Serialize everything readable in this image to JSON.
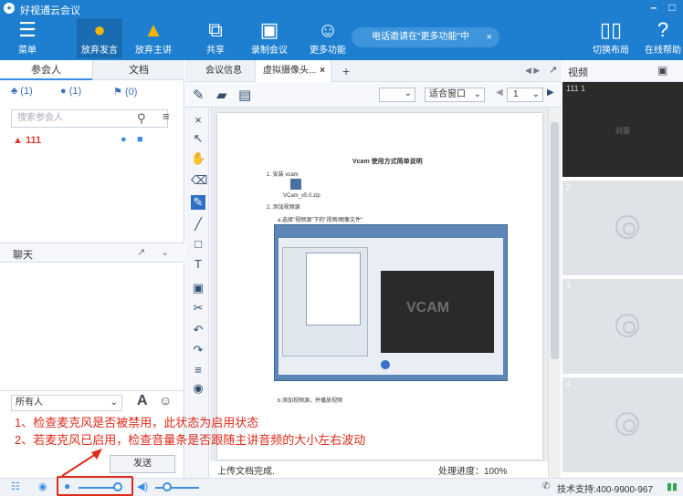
{
  "app": {
    "title": "好视通云会议"
  },
  "toolbar": {
    "menu": "菜单",
    "give_up_speaking": "放弃发言",
    "give_up_presenter": "放弃主讲",
    "share": "共享",
    "record": "录制会议",
    "more": "更多功能",
    "notice": "电话邀请在\"更多功能\"中",
    "switch_layout": "切换布局",
    "online_help": "在线帮助"
  },
  "left": {
    "tab_participants": "参会人",
    "tab_docs": "文档",
    "stats": [
      "(1)",
      "(1)",
      "(0)"
    ],
    "search_placeholder": "搜索参会人",
    "member_name": "111",
    "chat_label": "聊天",
    "recipient": "所有人",
    "send": "发送"
  },
  "center": {
    "tab_info": "会议信息",
    "tab_camera": "虚拟摄像头...",
    "fit_window": "适合窗口",
    "page": "1",
    "doc_title": "Vcam 使用方式简单说明",
    "doc_step1": "1. 安装 vcam",
    "doc_file": "VCam_v5.0.zip",
    "doc_step2": "2. 添加视频源",
    "doc_sub_a": "a.选择\"视频源\"下的\"视频/图像文件\"",
    "doc_sub_b": "b.添加视频源，并播放视频",
    "vcam_logo": "VCAM",
    "upload_done": "上传文档完成.",
    "progress": "处理进度：100%"
  },
  "right": {
    "title": "视频",
    "cell1_label": "111 1",
    "cell1_center": "封面",
    "cell_nums": [
      "2",
      "3",
      "4"
    ]
  },
  "annotation": {
    "line1": "1、检查麦克风是否被禁用，此状态为启用状态",
    "line2": "2、若麦克风已启用，检查音量条是否跟随主讲音频的大小左右波动"
  },
  "bottom": {
    "support": "技术支持:400-9900-967"
  },
  "colors": {
    "primary": "#1e7fd0",
    "alert": "#e02a1a",
    "link": "#3a8ee6"
  }
}
